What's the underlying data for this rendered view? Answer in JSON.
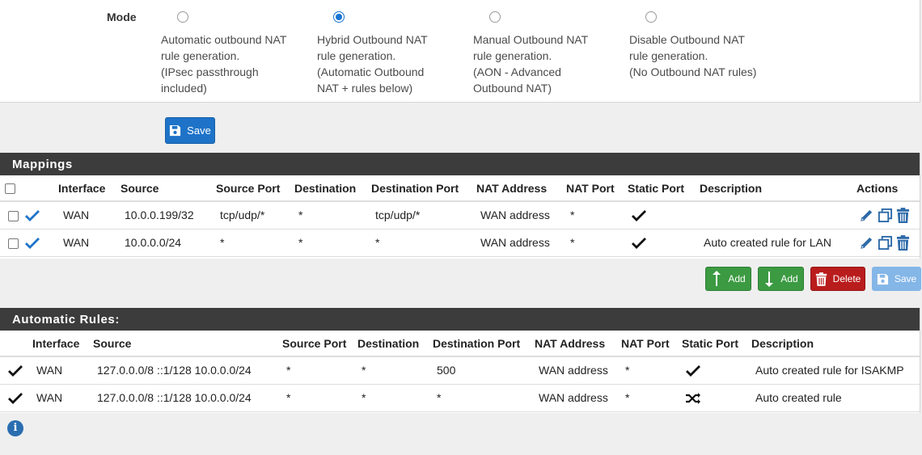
{
  "mode": {
    "label": "Mode",
    "options": [
      {
        "lines": [
          "Automatic outbound NAT",
          "rule generation.",
          "(IPsec passthrough",
          "included)"
        ],
        "checked": false
      },
      {
        "lines": [
          "Hybrid Outbound NAT",
          "rule generation.",
          "(Automatic Outbound",
          "NAT + rules below)"
        ],
        "checked": true
      },
      {
        "lines": [
          "Manual Outbound NAT",
          "rule generation.",
          "(AON - Advanced",
          "Outbound NAT)"
        ],
        "checked": false
      },
      {
        "lines": [
          "Disable Outbound NAT",
          "rule generation.",
          "(No Outbound NAT rules)"
        ],
        "checked": false
      }
    ],
    "save_label": "Save"
  },
  "mappings": {
    "title": "Mappings",
    "headers": [
      "Interface",
      "Source",
      "Source Port",
      "Destination",
      "Destination Port",
      "NAT Address",
      "NAT Port",
      "Static Port",
      "Description",
      "Actions"
    ],
    "rows": [
      {
        "interface": "WAN",
        "source": "10.0.0.199/32",
        "source_port": "tcp/udp/*",
        "destination": "*",
        "destination_port": "tcp/udp/*",
        "nat_address": "WAN address",
        "nat_port": "*",
        "description": ""
      },
      {
        "interface": "WAN",
        "source": "10.0.0.0/24",
        "source_port": "*",
        "destination": "*",
        "destination_port": "*",
        "nat_address": "WAN address",
        "nat_port": "*",
        "description": "Auto created rule for LAN"
      }
    ],
    "buttons": {
      "add_top": "Add",
      "add_bottom": "Add",
      "delete": "Delete",
      "save": "Save"
    }
  },
  "automatic": {
    "title": "Automatic Rules:",
    "headers": [
      "Interface",
      "Source",
      "Source Port",
      "Destination",
      "Destination Port",
      "NAT Address",
      "NAT Port",
      "Static Port",
      "Description"
    ],
    "rows": [
      {
        "interface": "WAN",
        "source": "127.0.0.0/8 ::1/128 10.0.0.0/24",
        "source_port": "*",
        "destination": "*",
        "destination_port": "500",
        "nat_address": "WAN address",
        "nat_port": "*",
        "static": "check",
        "description": "Auto created rule for ISAKMP"
      },
      {
        "interface": "WAN",
        "source": "127.0.0.0/8 ::1/128 10.0.0.0/24",
        "source_port": "*",
        "destination": "*",
        "destination_port": "*",
        "nat_address": "WAN address",
        "nat_port": "*",
        "static": "random",
        "description": "Auto created rule"
      }
    ]
  },
  "info_icon": "i",
  "colors": {
    "primary": "#1e73c8",
    "success": "#3b9a42",
    "danger": "#b91c1c",
    "header_bg": "#3c3c3c"
  }
}
